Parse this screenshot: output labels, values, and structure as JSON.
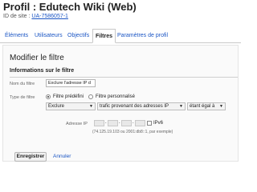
{
  "header": {
    "title": "Profil : Edutech Wiki (Web)",
    "site_id_label": "ID de site :",
    "site_id_value": "UA-7586057-1"
  },
  "tabs": [
    {
      "label": "Éléments"
    },
    {
      "label": "Utilisateurs"
    },
    {
      "label": "Objectifs"
    },
    {
      "label": "Filtres",
      "active": true
    },
    {
      "label": "Paramètres de profil"
    }
  ],
  "panel": {
    "title": "Modifier le filtre",
    "section": "Informations sur le filtre",
    "filter_name_label": "Nom du filtre",
    "filter_name_value": "Exclure l'adresse IP d",
    "filter_type_label": "Type de filtre",
    "predefined_label": "Filtre prédéfini",
    "custom_label": "Filtre personnalisé",
    "select_exclude": "Exclure",
    "select_traffic": "trafic provenant des adresses IP",
    "select_equal": "étant égal à",
    "ip_label": "Adresse IP",
    "ipv6_label": "IPv6",
    "ip_hint": "(74.125.19.103 ou 2001:db8::1, par exemple)"
  },
  "actions": {
    "save": "Enregistrer",
    "cancel": "Annuler"
  }
}
